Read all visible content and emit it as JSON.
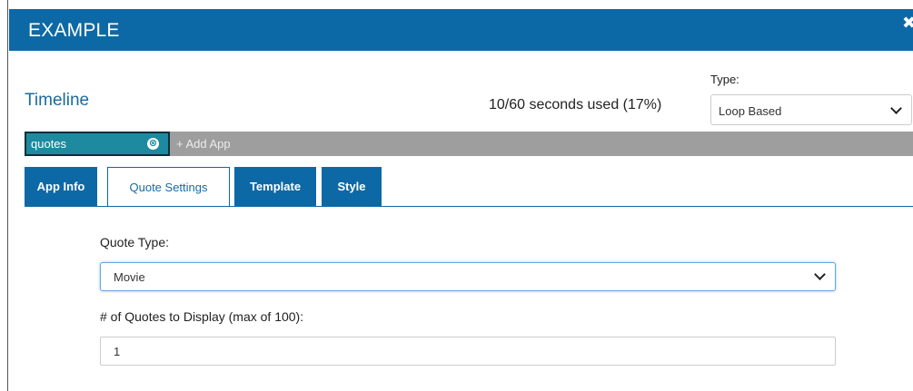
{
  "header": {
    "title": "EXAMPLE",
    "close_glyph": "✖"
  },
  "timeline": {
    "title": "Timeline",
    "usage": "10/60 seconds used (17%)",
    "type_label": "Type:",
    "type_value": "Loop Based"
  },
  "apps": {
    "chips": [
      {
        "name": "quotes",
        "remove_glyph": "⊗"
      }
    ],
    "add_label": "+ Add App"
  },
  "tabs": [
    {
      "label": "App Info",
      "active": false
    },
    {
      "label": "Quote Settings",
      "active": true
    },
    {
      "label": "Template",
      "active": false
    },
    {
      "label": "Style",
      "active": false
    }
  ],
  "form": {
    "quote_type_label": "Quote Type:",
    "quote_type_value": "Movie",
    "count_label": "# of Quotes to Display (max of 100):",
    "count_value": "1"
  },
  "colors": {
    "header_bg": "#0d69a5",
    "chip_bg": "#1d8a9f",
    "bar_bg": "#9e9e9e",
    "title_text": "#1a6b9e"
  },
  "icons": [
    "close-icon",
    "remove-chip-icon",
    "chevron-down-icon"
  ]
}
